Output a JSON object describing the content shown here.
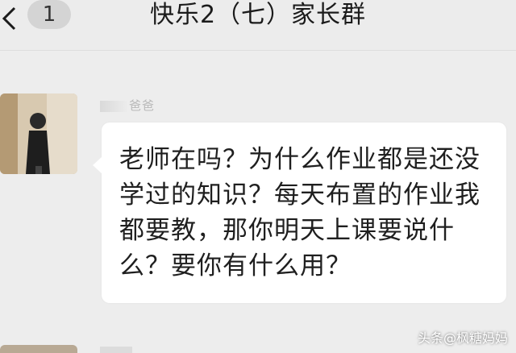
{
  "header": {
    "back_icon": "chevron-left-icon",
    "unread_count": "1",
    "title": "快乐2（七）家长群"
  },
  "message": {
    "sender_name": "爸爸",
    "text": "老师在吗？为什么作业都是还没学过的知识？每天布置的作业我都要教，那你明天上课要说什么？要你有什么用？"
  },
  "watermark": "头条@枫糖妈妈"
}
